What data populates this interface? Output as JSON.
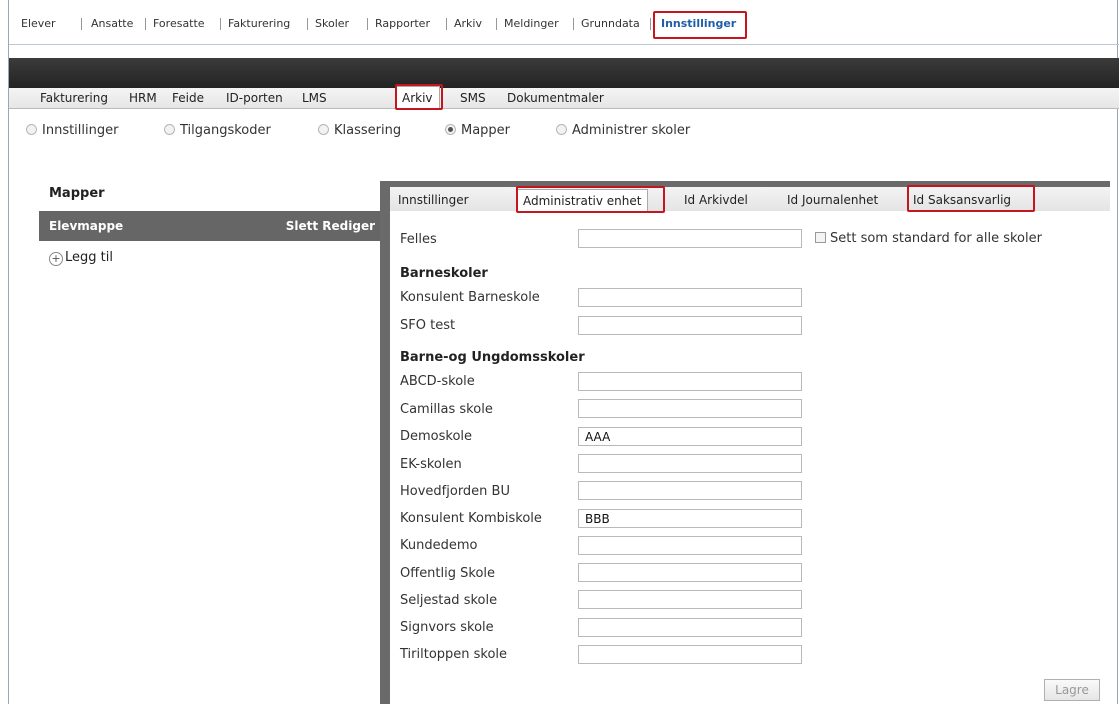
{
  "topnav": {
    "items": [
      "Elever",
      "Ansatte",
      "Foresatte",
      "Fakturering",
      "Skoler",
      "Rapporter",
      "Arkiv",
      "Meldinger",
      "Grunndata",
      "Innstillinger"
    ]
  },
  "subtabs": [
    "Fakturering",
    "HRM",
    "Feide",
    "ID-porten",
    "LMS",
    "Arkiv",
    "SMS",
    "Dokumentmaler"
  ],
  "radios": [
    {
      "label": "Innstillinger",
      "selected": false
    },
    {
      "label": "Tilgangskoder",
      "selected": false
    },
    {
      "label": "Klassering",
      "selected": false
    },
    {
      "label": "Mapper",
      "selected": true
    },
    {
      "label": "Administrer skoler",
      "selected": false
    }
  ],
  "left": {
    "title": "Mapper",
    "row_name": "Elevmappe",
    "delete": "Slett",
    "edit": "Rediger",
    "add": "Legg til"
  },
  "right": {
    "tabs": [
      "Innstillinger",
      "Administrativ enhet",
      "Id Arkivdel",
      "Id Journalenhet",
      "Id Saksansvarlig"
    ],
    "felles_label": "Felles",
    "felles_value": "",
    "default_checkbox": "Sett som standard for alle skoler",
    "group1_title": "Barneskoler",
    "group1": [
      {
        "label": "Konsulent Barneskole",
        "value": ""
      },
      {
        "label": "SFO test",
        "value": ""
      }
    ],
    "group2_title": "Barne-og Ungdomsskoler",
    "group2": [
      {
        "label": "ABCD-skole",
        "value": ""
      },
      {
        "label": "Camillas skole",
        "value": ""
      },
      {
        "label": "Demoskole",
        "value": "AAA"
      },
      {
        "label": "EK-skolen",
        "value": ""
      },
      {
        "label": "Hovedfjorden BU",
        "value": ""
      },
      {
        "label": "Konsulent Kombiskole",
        "value": "BBB"
      },
      {
        "label": "Kundedemo",
        "value": ""
      },
      {
        "label": "Offentlig Skole",
        "value": ""
      },
      {
        "label": "Seljestad skole",
        "value": ""
      },
      {
        "label": "Signvors skole",
        "value": ""
      },
      {
        "label": "Tiriltoppen skole",
        "value": ""
      }
    ],
    "save": "Lagre"
  },
  "colors": {
    "highlight": "#c4161c",
    "active_link": "#1f5ea8",
    "dark_bar": "#2e2e2e",
    "panel": "#6a6a6a"
  }
}
